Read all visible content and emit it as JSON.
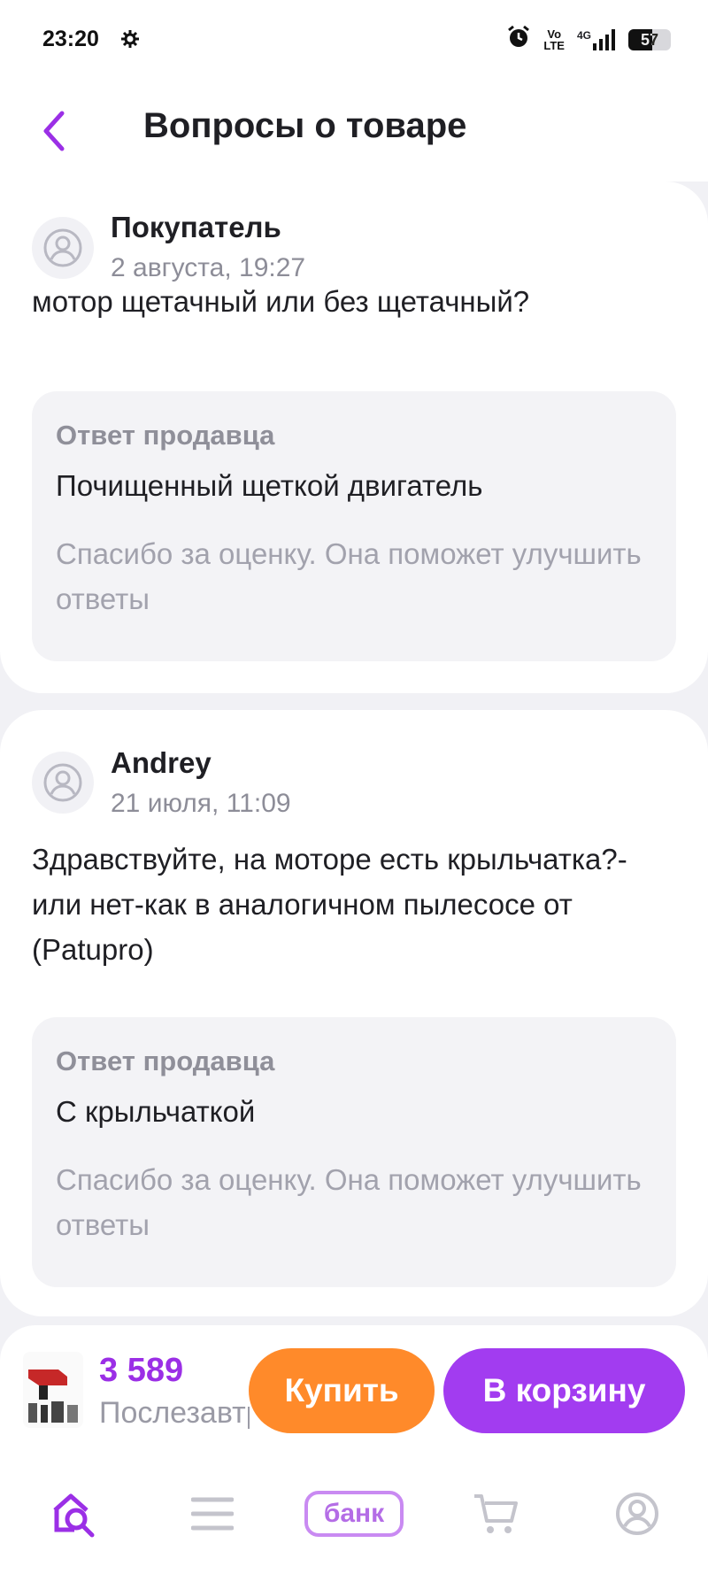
{
  "status_bar": {
    "time": "23:20",
    "network": "4G",
    "volte_top": "Vo",
    "volte_bottom": "LTE",
    "battery": "57"
  },
  "header": {
    "title": "Вопросы о товаре",
    "back_icon": "chevron-left-icon",
    "accent_color": "#9b2fe6"
  },
  "questions": [
    {
      "author": "Покупатель",
      "date": "2 августа, 19:27",
      "text": "мотор щетачный или без щетачный?",
      "answer_heading": "Ответ продавца",
      "answer": "Почищенный щеткой двигатель",
      "thanks": "Спасибо за оценку. Она поможет улучшить ответы"
    },
    {
      "author": "Andrey",
      "date": "21 июля, 11:09",
      "text": "Здравствуйте, на моторе есть крыльчатка?- или нет-как в аналогичном пылесосе от (Patupro)",
      "answer_heading": "Ответ продавца",
      "answer": "С крыльчаткой",
      "thanks": "Спасибо за оценку. Она поможет улучшить ответы"
    }
  ],
  "buy_panel": {
    "price": "3 589",
    "subtitle": "Послезавтра",
    "buy_label": "Купить",
    "cart_label": "В корзину",
    "buy_color": "#ff8a2a",
    "cart_color": "#a23cf0"
  },
  "bottom_nav": {
    "bank_label": "банк",
    "items": [
      "home-search-icon",
      "catalog-menu-icon",
      "bank-icon",
      "cart-icon",
      "profile-icon"
    ]
  }
}
